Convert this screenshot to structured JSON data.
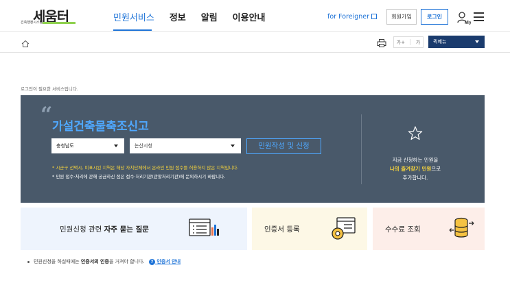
{
  "header": {
    "logo": {
      "main": "세움터",
      "sub": "건축행정시스템"
    },
    "nav": [
      {
        "label": "민원서비스"
      },
      {
        "label": "정보"
      },
      {
        "label": "알림"
      },
      {
        "label": "이용안내"
      }
    ],
    "foreigner_label": "for Foreigner",
    "join_label": "회원가입",
    "login_label": "로그인",
    "my_label": "My"
  },
  "locbar": {
    "font_increase": "가+",
    "font_decrease": "가",
    "quickmenu_label": "퀵메뉴"
  },
  "login_note": "로그인이 필요한 서비스입니다.",
  "banner": {
    "title": "가설건축물축조신고",
    "province_select": "충청남도",
    "city_select": "논산시청",
    "apply_button": "민원작성 및 신청",
    "note_yellow": "* 시군구 선택시, 미표시된 지역은 해당 자치단체에서 온라인 민원 접수를 허용하지 않은 지역입니다.",
    "note_white": "* 민원 접수·처리에 관해 궁금하신 점은 접수·처리기관(관할처리기관)에 문의하시기 바랍니다.",
    "favorite": {
      "line1": "지금 신청하는 민원을",
      "highlight": "나의 즐겨찾기 민원",
      "line2_suffix": "으로",
      "line3": "추가합니다."
    }
  },
  "cards": {
    "faq": {
      "prefix": "민원신청 관련 ",
      "bold": "자주 묻는 질문"
    },
    "cert": {
      "label": "인증서 등록"
    },
    "fee": {
      "label": "수수료 조회"
    }
  },
  "bottom_note": {
    "prefix": "민원신청을 하실때에는 ",
    "bold": "인증서의 인증",
    "suffix": "을 거쳐야 합니다.",
    "link": "인증서 안내"
  },
  "colors": {
    "accent": "#1e73d7",
    "banner_bg": "#49596a",
    "banner_title": "#4fa8ff",
    "highlight_yellow": "#f5d33c",
    "quickmenu_bg": "#1a3b6d"
  }
}
